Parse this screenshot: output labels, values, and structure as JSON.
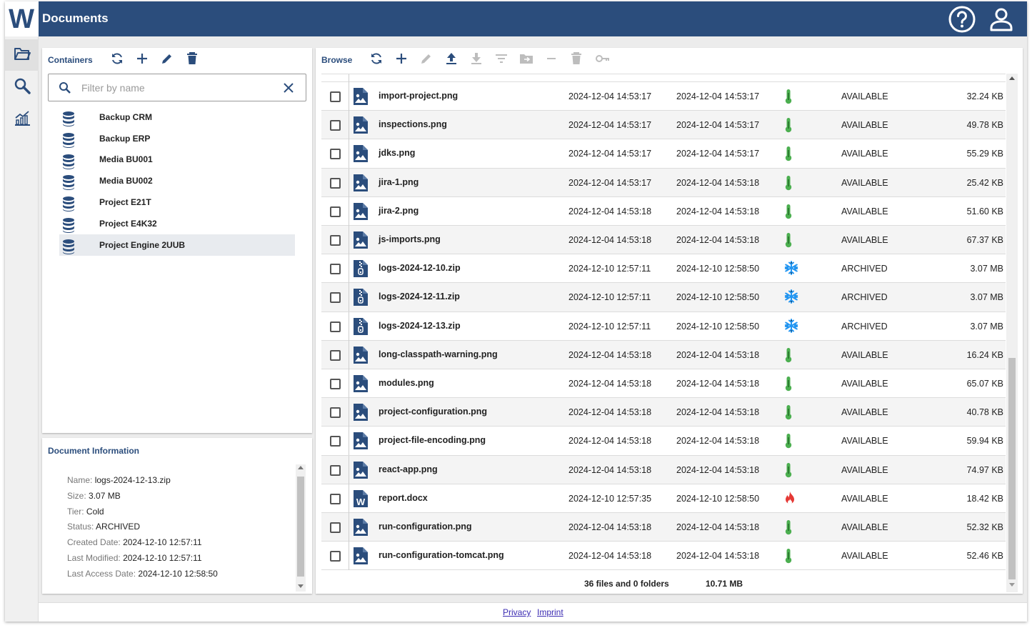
{
  "app": {
    "title": "Documents",
    "logo_letter": "W"
  },
  "header": {
    "help_icon": "help-circle-icon",
    "user_icon": "user-account-icon"
  },
  "nav": [
    {
      "icon": "folder-icon",
      "active": true
    },
    {
      "icon": "search-icon",
      "active": false
    },
    {
      "icon": "analytics-chart-icon",
      "active": false
    }
  ],
  "containers": {
    "title": "Containers",
    "filter_placeholder": "Filter by name",
    "filter_value": "",
    "items": [
      {
        "label": "Backup CRM",
        "selected": false
      },
      {
        "label": "Backup ERP",
        "selected": false
      },
      {
        "label": "Media BU001",
        "selected": false
      },
      {
        "label": "Media BU002",
        "selected": false
      },
      {
        "label": "Project E21T",
        "selected": false
      },
      {
        "label": "Project E4K32",
        "selected": false
      },
      {
        "label": "Project Engine 2UUB",
        "selected": true
      }
    ]
  },
  "doc_info": {
    "title": "Document Information",
    "name_label": "Name:",
    "name": "logs-2024-12-13.zip",
    "size_label": "Size:",
    "size": "3.07 MB",
    "tier_label": "Tier:",
    "tier": "Cold",
    "status_label": "Status:",
    "status": "ARCHIVED",
    "created_label": "Created Date:",
    "created": "2024-12-10 12:57:11",
    "modified_label": "Last Modified:",
    "modified": "2024-12-10 12:57:11",
    "access_label": "Last Access Date:",
    "access": "2024-12-10 12:58:50"
  },
  "browse": {
    "title": "Browse",
    "files": [
      {
        "name": "import-project.png",
        "type": "image",
        "created": "2024-12-04 14:53:17",
        "accessed": "2024-12-04 14:53:17",
        "tier": "hot",
        "status": "AVAILABLE",
        "size": "32.24 KB"
      },
      {
        "name": "inspections.png",
        "type": "image",
        "created": "2024-12-04 14:53:17",
        "accessed": "2024-12-04 14:53:17",
        "tier": "hot",
        "status": "AVAILABLE",
        "size": "49.78 KB"
      },
      {
        "name": "jdks.png",
        "type": "image",
        "created": "2024-12-04 14:53:17",
        "accessed": "2024-12-04 14:53:17",
        "tier": "hot",
        "status": "AVAILABLE",
        "size": "55.29 KB"
      },
      {
        "name": "jira-1.png",
        "type": "image",
        "created": "2024-12-04 14:53:17",
        "accessed": "2024-12-04 14:53:18",
        "tier": "hot",
        "status": "AVAILABLE",
        "size": "25.42 KB"
      },
      {
        "name": "jira-2.png",
        "type": "image",
        "created": "2024-12-04 14:53:18",
        "accessed": "2024-12-04 14:53:18",
        "tier": "hot",
        "status": "AVAILABLE",
        "size": "51.60 KB"
      },
      {
        "name": "js-imports.png",
        "type": "image",
        "created": "2024-12-04 14:53:18",
        "accessed": "2024-12-04 14:53:18",
        "tier": "hot",
        "status": "AVAILABLE",
        "size": "67.37 KB"
      },
      {
        "name": "logs-2024-12-10.zip",
        "type": "zip",
        "created": "2024-12-10 12:57:11",
        "accessed": "2024-12-10 12:58:50",
        "tier": "cold",
        "status": "ARCHIVED",
        "size": "3.07 MB"
      },
      {
        "name": "logs-2024-12-11.zip",
        "type": "zip",
        "created": "2024-12-10 12:57:11",
        "accessed": "2024-12-10 12:58:50",
        "tier": "cold",
        "status": "ARCHIVED",
        "size": "3.07 MB"
      },
      {
        "name": "logs-2024-12-13.zip",
        "type": "zip",
        "created": "2024-12-10 12:57:11",
        "accessed": "2024-12-10 12:58:50",
        "tier": "cold",
        "status": "ARCHIVED",
        "size": "3.07 MB"
      },
      {
        "name": "long-classpath-warning.png",
        "type": "image",
        "created": "2024-12-04 14:53:18",
        "accessed": "2024-12-04 14:53:18",
        "tier": "hot",
        "status": "AVAILABLE",
        "size": "16.24 KB"
      },
      {
        "name": "modules.png",
        "type": "image",
        "created": "2024-12-04 14:53:18",
        "accessed": "2024-12-04 14:53:18",
        "tier": "hot",
        "status": "AVAILABLE",
        "size": "65.07 KB"
      },
      {
        "name": "project-configuration.png",
        "type": "image",
        "created": "2024-12-04 14:53:18",
        "accessed": "2024-12-04 14:53:18",
        "tier": "hot",
        "status": "AVAILABLE",
        "size": "40.78 KB"
      },
      {
        "name": "project-file-encoding.png",
        "type": "image",
        "created": "2024-12-04 14:53:18",
        "accessed": "2024-12-04 14:53:18",
        "tier": "hot",
        "status": "AVAILABLE",
        "size": "59.94 KB"
      },
      {
        "name": "react-app.png",
        "type": "image",
        "created": "2024-12-04 14:53:18",
        "accessed": "2024-12-04 14:53:18",
        "tier": "hot",
        "status": "AVAILABLE",
        "size": "74.97 KB"
      },
      {
        "name": "report.docx",
        "type": "word",
        "created": "2024-12-10 12:57:35",
        "accessed": "2024-12-10 12:58:50",
        "tier": "fire",
        "status": "AVAILABLE",
        "size": "18.42 KB"
      },
      {
        "name": "run-configuration.png",
        "type": "image",
        "created": "2024-12-04 14:53:18",
        "accessed": "2024-12-04 14:53:18",
        "tier": "hot",
        "status": "AVAILABLE",
        "size": "52.32 KB"
      },
      {
        "name": "run-configuration-tomcat.png",
        "type": "image",
        "created": "2024-12-04 14:53:18",
        "accessed": "2024-12-04 14:53:18",
        "tier": "hot",
        "status": "AVAILABLE",
        "size": "52.46 KB"
      }
    ],
    "summary_count": "36 files and 0 folders",
    "summary_size": "10.71 MB"
  },
  "footer": {
    "privacy": "Privacy",
    "imprint": "Imprint"
  },
  "colors": {
    "brand": "#2b4d7c",
    "hot": "#4caf50",
    "cold": "#2196f3",
    "fire": "#e53935"
  }
}
